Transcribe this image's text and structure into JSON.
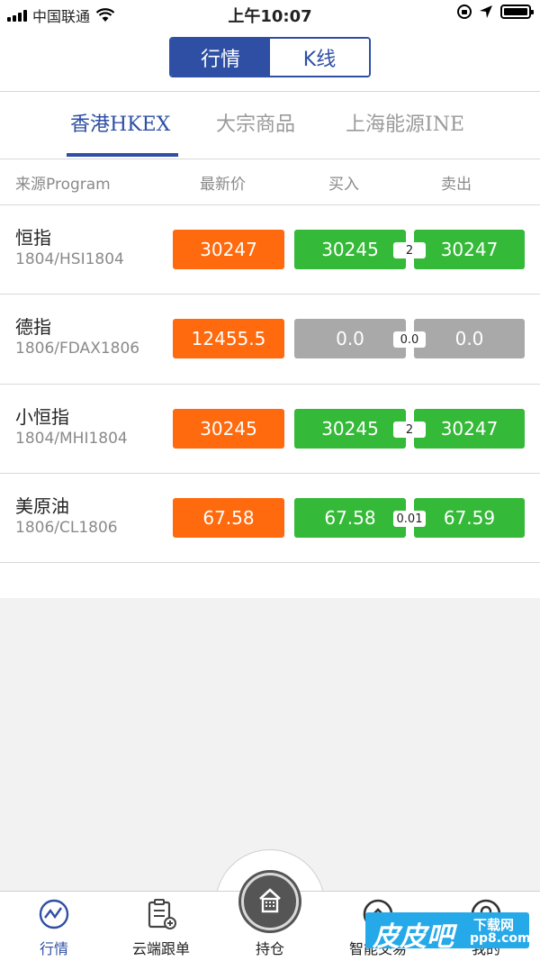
{
  "status_bar": {
    "carrier": "中国联通",
    "time": "上午10:07"
  },
  "segment": {
    "tabs": [
      {
        "label": "行情",
        "active": true
      },
      {
        "label": "K线",
        "active": false
      }
    ]
  },
  "exchange_tabs": [
    {
      "label": "香港HKEX",
      "active": true
    },
    {
      "label": "大宗商品",
      "active": false
    },
    {
      "label": "上海能源INE",
      "active": false
    }
  ],
  "table": {
    "headers": [
      "来源Program",
      "最新价",
      "买入",
      "卖出"
    ],
    "rows": [
      {
        "name": "恒指",
        "code": "1804/HSI1804",
        "last": "30247",
        "bid": "30245",
        "spread": "2",
        "ask": "30247",
        "state": "green"
      },
      {
        "name": "德指",
        "code": "1806/FDAX1806",
        "last": "12455.5",
        "bid": "0.0",
        "spread": "0.0",
        "ask": "0.0",
        "state": "gray"
      },
      {
        "name": "小恒指",
        "code": "1804/MHI1804",
        "last": "30245",
        "bid": "30245",
        "spread": "2",
        "ask": "30247",
        "state": "green"
      },
      {
        "name": "美原油",
        "code": "1806/CL1806",
        "last": "67.58",
        "bid": "67.58",
        "spread": "0.01",
        "ask": "67.59",
        "state": "green"
      }
    ]
  },
  "bottom_nav": {
    "items": [
      {
        "label": "行情",
        "icon": "market-chart-icon",
        "active": true
      },
      {
        "label": "云端跟单",
        "icon": "clipboard-add-icon",
        "active": false
      },
      {
        "label": "持仓",
        "icon": "building-icon",
        "active": false
      },
      {
        "label": "智能交易",
        "icon": "smart-trade-icon",
        "active": false
      },
      {
        "label": "我的",
        "icon": "user-icon",
        "active": false
      }
    ]
  },
  "watermark": {
    "main": "皮皮吧",
    "sub1": "下载网",
    "sub2": "pp8.com"
  },
  "colors": {
    "accent": "#2e4fa3",
    "last_price": "#ff6a0e",
    "green": "#35b938",
    "gray": "#a9a9a9",
    "watermark": "#26a9e8"
  }
}
